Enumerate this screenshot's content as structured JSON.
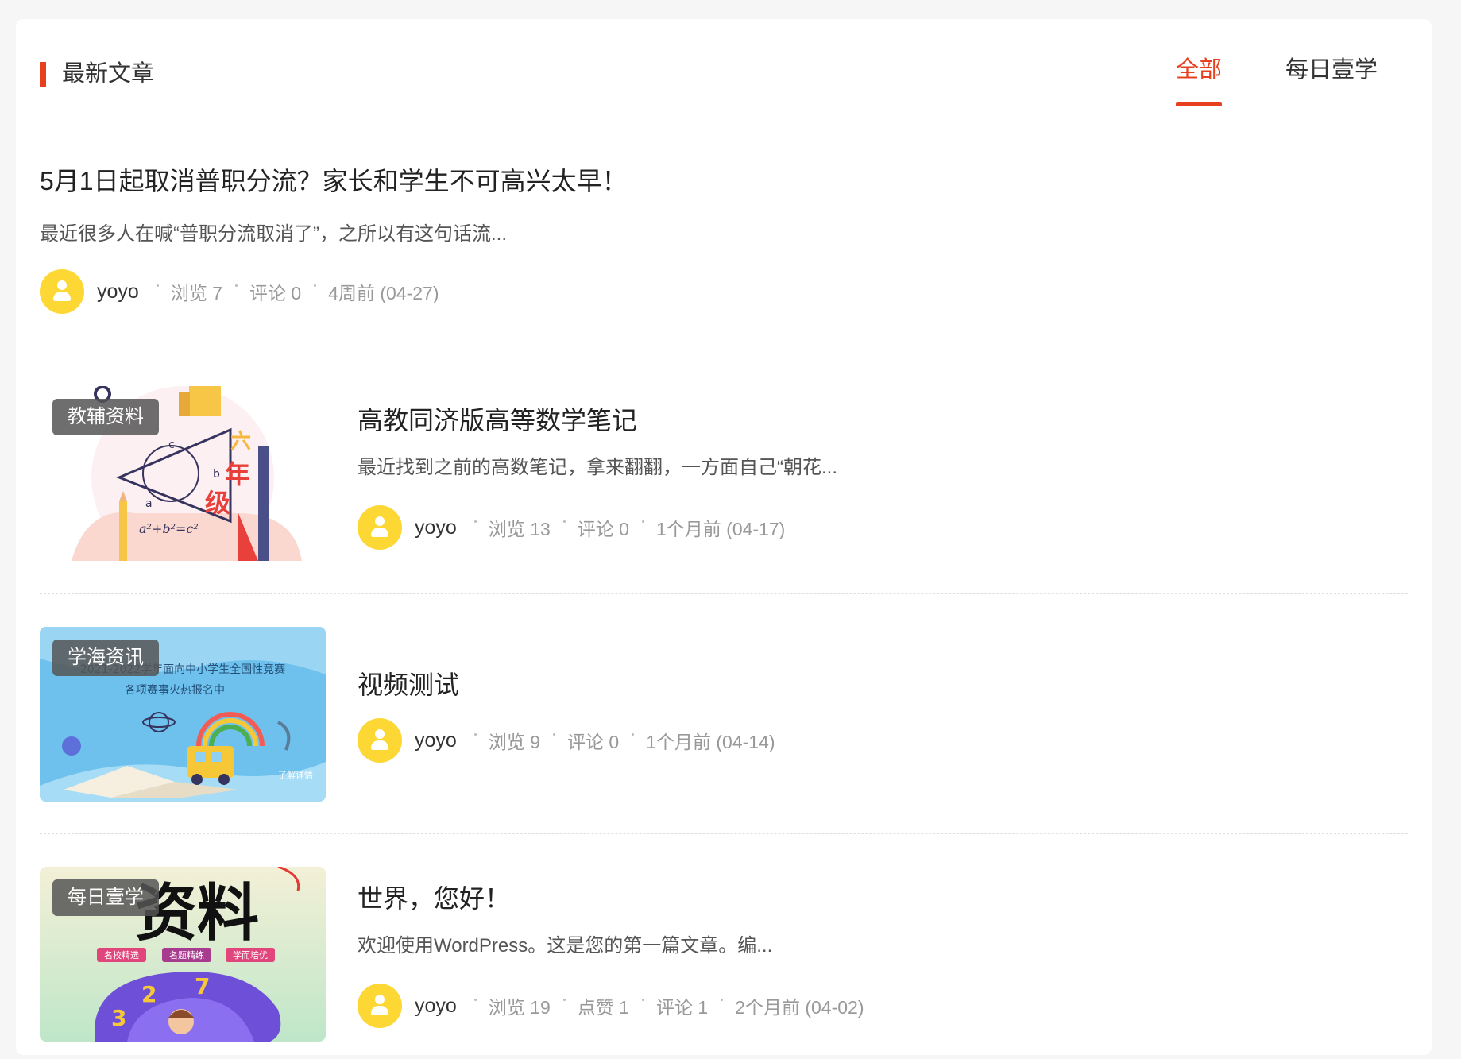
{
  "section": {
    "title": "最新文章",
    "accent": "#e8401e"
  },
  "tabs": [
    {
      "label": "全部",
      "active": true
    },
    {
      "label": "每日壹学",
      "active": false
    }
  ],
  "posts": [
    {
      "title": "5月1日起取消普职分流？家长和学生不可高兴太早！",
      "excerpt": "最近很多人在喊“普职分流取消了”，之所以有这句话流...",
      "author": "yoyo",
      "stats": [
        "浏览 7",
        "评论 0",
        "4周前 (04-27)"
      ]
    },
    {
      "badge": "教辅资料",
      "thumb_text": {
        "c": "c",
        "b": "b",
        "a": "a",
        "formula": "a²+b²=c²",
        "grade1": "六",
        "grade2": "年",
        "grade3": "级"
      },
      "title": "高教同济版高等数学笔记",
      "excerpt": "最近找到之前的高数笔记，拿来翻翻，一方面自己“朝花...",
      "author": "yoyo",
      "stats": [
        "浏览 13",
        "评论 0",
        "1个月前 (04-17)"
      ]
    },
    {
      "badge": "学海资讯",
      "thumb_text": {
        "line1": "2021-2022学年面向中小学生全国性竞赛",
        "line2": "各项赛事火热报名中",
        "corner": "了解详情"
      },
      "title": "视频测试",
      "excerpt": "",
      "author": "yoyo",
      "stats": [
        "浏览 9",
        "评论 0",
        "1个月前 (04-14)"
      ]
    },
    {
      "badge": "每日壹学",
      "thumb_text": {
        "big": "资料",
        "tag1": "名校精选",
        "tag2": "名题精练",
        "tag3": "学而培优"
      },
      "title": "世界，您好！",
      "excerpt": "欢迎使用WordPress。这是您的第一篇文章。编...",
      "author": "yoyo",
      "stats": [
        "浏览 19",
        "点赞 1",
        "评论 1",
        "2个月前 (04-02)"
      ]
    }
  ]
}
